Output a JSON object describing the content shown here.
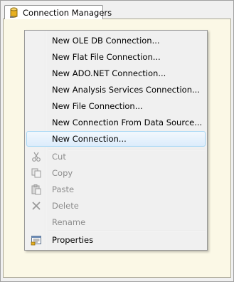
{
  "tab": {
    "label": "Connection Managers",
    "icon": "database-icon"
  },
  "menu": {
    "items": [
      {
        "label": "New OLE DB Connection...",
        "enabled": true
      },
      {
        "label": "New Flat File Connection...",
        "enabled": true
      },
      {
        "label": "New ADO.NET Connection...",
        "enabled": true
      },
      {
        "label": "New Analysis Services Connection...",
        "enabled": true
      },
      {
        "label": "New File Connection...",
        "enabled": true
      },
      {
        "label": "New Connection From Data Source...",
        "enabled": true
      },
      {
        "label": "New Connection...",
        "enabled": true,
        "highlighted": true
      },
      {
        "label": "Cut",
        "enabled": false,
        "icon": "scissors-icon"
      },
      {
        "label": "Copy",
        "enabled": false,
        "icon": "copy-icon"
      },
      {
        "label": "Paste",
        "enabled": false,
        "icon": "paste-icon"
      },
      {
        "label": "Delete",
        "enabled": false,
        "icon": "delete-icon"
      },
      {
        "label": "Rename",
        "enabled": false
      },
      {
        "label": "Properties",
        "enabled": true,
        "icon": "properties-icon"
      }
    ]
  },
  "colors": {
    "panel_background": "#fbf8e6",
    "highlight_border": "#a8d8f5",
    "disabled_text": "#8d8d8d"
  }
}
